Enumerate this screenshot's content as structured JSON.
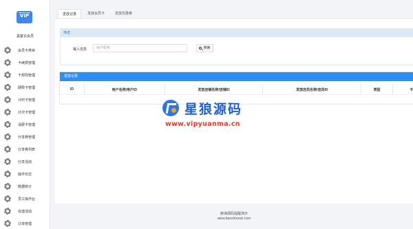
{
  "brand": {
    "logo_text": "VIP",
    "name": "黑客云会员"
  },
  "sidebar": {
    "items": [
      {
        "label": "会员卡类目"
      },
      {
        "label": "卡续费管理"
      },
      {
        "label": "卡规则管理"
      },
      {
        "label": "期限卡管理"
      },
      {
        "label": "计时卡管理"
      },
      {
        "label": "计次卡管理"
      },
      {
        "label": "消费卡管理"
      },
      {
        "label": "分享券管理"
      },
      {
        "label": "分享券列表"
      },
      {
        "label": "分享活动"
      },
      {
        "label": "操作日志"
      },
      {
        "label": "数据统计"
      },
      {
        "label": "员工操作台"
      },
      {
        "label": "充值活动"
      },
      {
        "label": "订单管理"
      }
    ]
  },
  "tabs": [
    {
      "label": "发放记录",
      "active": true
    },
    {
      "label": "发放会员卡",
      "active": false
    },
    {
      "label": "发放优惠券",
      "active": false
    }
  ],
  "filter": {
    "title": "筛选",
    "input_label": "输入信息",
    "input_placeholder": "用户昵称",
    "search_label": "搜索"
  },
  "records": {
    "title": "发放记录",
    "columns": [
      "ID",
      "用户名称/用户ID",
      "发放店铺名称/店铺ID",
      "发放店员名称/店员ID",
      "类型",
      "卡"
    ]
  },
  "watermark": {
    "title": "星狼源码",
    "url": "www.vipyuanma.cn"
  },
  "footer": {
    "line1": "麻海源码提醒演示",
    "line2": "www.banshouwo.com"
  },
  "colors": {
    "accent": "#2f8ef6",
    "filter_header": "#dbe9f2",
    "watermark_red": "#e03a2a",
    "watermark_blue": "#1f5fd0"
  }
}
